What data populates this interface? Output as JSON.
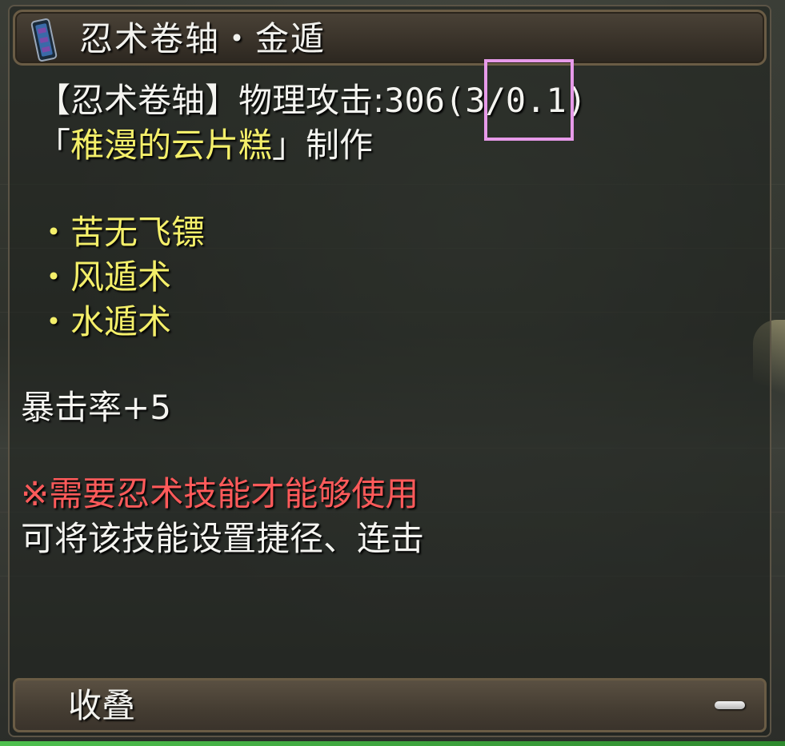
{
  "tooltip": {
    "title": "忍术卷轴・金遁",
    "stat_prefix": "【忍术卷轴】物理攻击:",
    "attack_value": "306",
    "attack_detail": "(3/0.1)",
    "crafter_open": "「",
    "crafter_name": "稚漫的云片糕",
    "crafter_close": "」",
    "crafter_suffix": "制作",
    "skills": [
      "・苦无飞镖",
      "・风遁术",
      "・水遁术"
    ],
    "bonus": "暴击率+5",
    "requirement": "※需要忍术技能才能够使用",
    "note": "可将该技能设置捷径、连击",
    "collapse_label": "收叠"
  },
  "colors": {
    "white_text": "#f4f4f0",
    "yellow_text": "#f4ef6a",
    "red_text": "#ff5a5a",
    "highlight_border": "#e79ae9",
    "frame_brown": "#6a5c45"
  },
  "icons": {
    "title_icon": "scroll-icon",
    "collapse_icon": "minus-icon"
  }
}
